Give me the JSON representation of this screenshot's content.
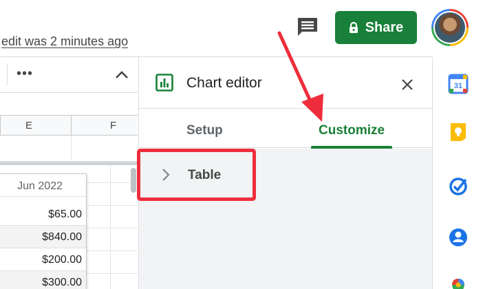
{
  "header": {
    "last_edit": "edit was 2 minutes ago",
    "share_label": "Share",
    "comment_icon": "comment-icon",
    "lock_icon": "lock-icon"
  },
  "toolbar": {
    "more_label": "•••",
    "collapse_icon": "chevron-up-icon"
  },
  "sheet": {
    "columns": [
      "E",
      "F"
    ],
    "table": {
      "header": "Jun 2022",
      "cells": [
        "$65.00",
        "$840.00",
        "$200.00",
        "$300.00"
      ]
    }
  },
  "chart_editor": {
    "title": "Chart editor",
    "tabs": [
      {
        "label": "Setup",
        "active": false
      },
      {
        "label": "Customize",
        "active": true
      }
    ],
    "sections": [
      {
        "label": "Table",
        "expanded": false
      }
    ]
  },
  "side_panel": {
    "calendar_day": "31",
    "icons": [
      "calendar-icon",
      "keep-icon",
      "tasks-icon",
      "contacts-icon",
      "maps-icon"
    ]
  },
  "colors": {
    "accent_green": "#188038",
    "annotation_red": "#ee2d3c"
  }
}
